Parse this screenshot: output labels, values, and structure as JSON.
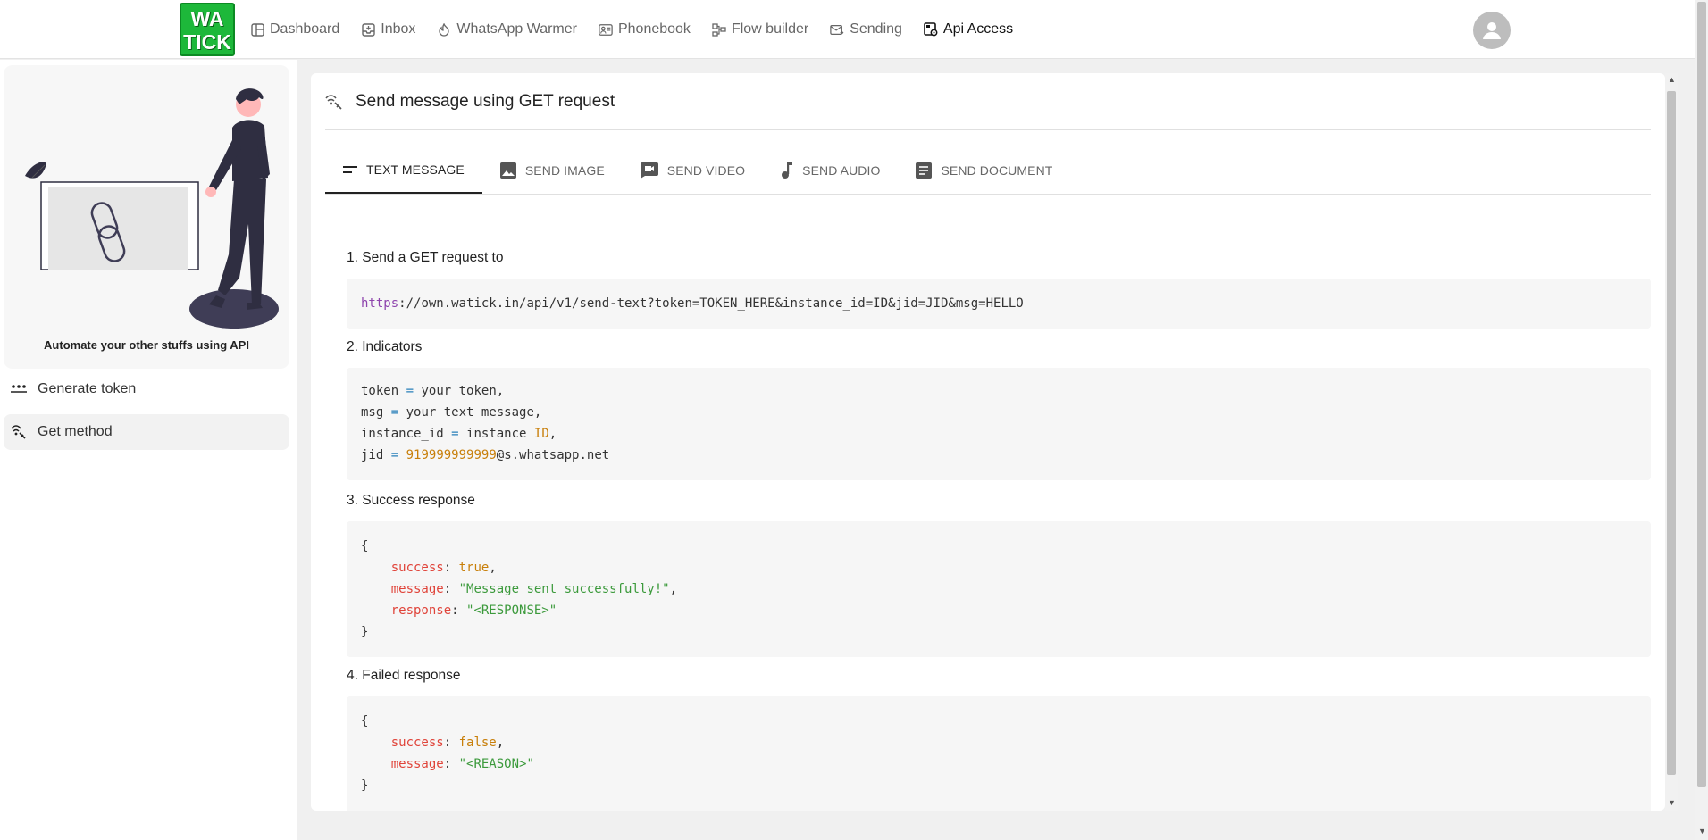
{
  "brand": {
    "line1": "WA",
    "line2": "TICK"
  },
  "nav": [
    {
      "label": "Dashboard",
      "icon": "layout-icon",
      "active": false
    },
    {
      "label": "Inbox",
      "icon": "inbox-icon",
      "active": false
    },
    {
      "label": "WhatsApp Warmer",
      "icon": "flame-icon",
      "active": false
    },
    {
      "label": "Phonebook",
      "icon": "contacts-icon",
      "active": false
    },
    {
      "label": "Flow builder",
      "icon": "flow-icon",
      "active": false
    },
    {
      "label": "Sending",
      "icon": "mail-send-icon",
      "active": false
    },
    {
      "label": "Api Access",
      "icon": "api-icon",
      "active": true
    }
  ],
  "sidebar": {
    "caption": "Automate your other stuffs using API",
    "items": [
      {
        "label": "Generate token",
        "icon": "token-icon",
        "active": false
      },
      {
        "label": "Get method",
        "icon": "get-method-icon",
        "active": true
      }
    ]
  },
  "card": {
    "title": "Send message using GET request",
    "tabs": [
      {
        "label": "TEXT MESSAGE",
        "icon": "text-lines-icon",
        "active": true
      },
      {
        "label": "SEND IMAGE",
        "icon": "image-icon",
        "active": false
      },
      {
        "label": "SEND VIDEO",
        "icon": "video-icon",
        "active": false
      },
      {
        "label": "SEND AUDIO",
        "icon": "music-note-icon",
        "active": false
      },
      {
        "label": "SEND DOCUMENT",
        "icon": "document-icon",
        "active": false
      }
    ],
    "sections": {
      "s1": "1. Send a GET request to",
      "s2": "2. Indicators",
      "s3": "3. Success response",
      "s4": "4. Failed response"
    },
    "request_url": {
      "scheme": "https",
      "rest": "://own.watick.in/api/v1/send-text?token=TOKEN_HERE&instance_id=ID&jid=JID&msg=HELLO"
    },
    "indicators": {
      "token_key": "token",
      "token_val": "your token,",
      "msg_key": "msg",
      "msg_val": "your text message,",
      "inst_key": "instance_id",
      "inst_val_a": "instance",
      "inst_val_b": "ID",
      "inst_val_c": ",",
      "jid_key": "jid",
      "jid_num": "919999999999",
      "jid_rest": "@s.whatsapp.net",
      "eq": "="
    },
    "success": {
      "open": "{",
      "close": "}",
      "k1": "success",
      "v1": "true",
      "k2": "message",
      "v2": "\"Message sent successfully!\"",
      "k3": "response",
      "v3": "\"<RESPONSE>\""
    },
    "failed": {
      "open": "{",
      "close": "}",
      "k1": "success",
      "v1": "false",
      "k2": "message",
      "v2": "\"<REASON>\""
    }
  }
}
